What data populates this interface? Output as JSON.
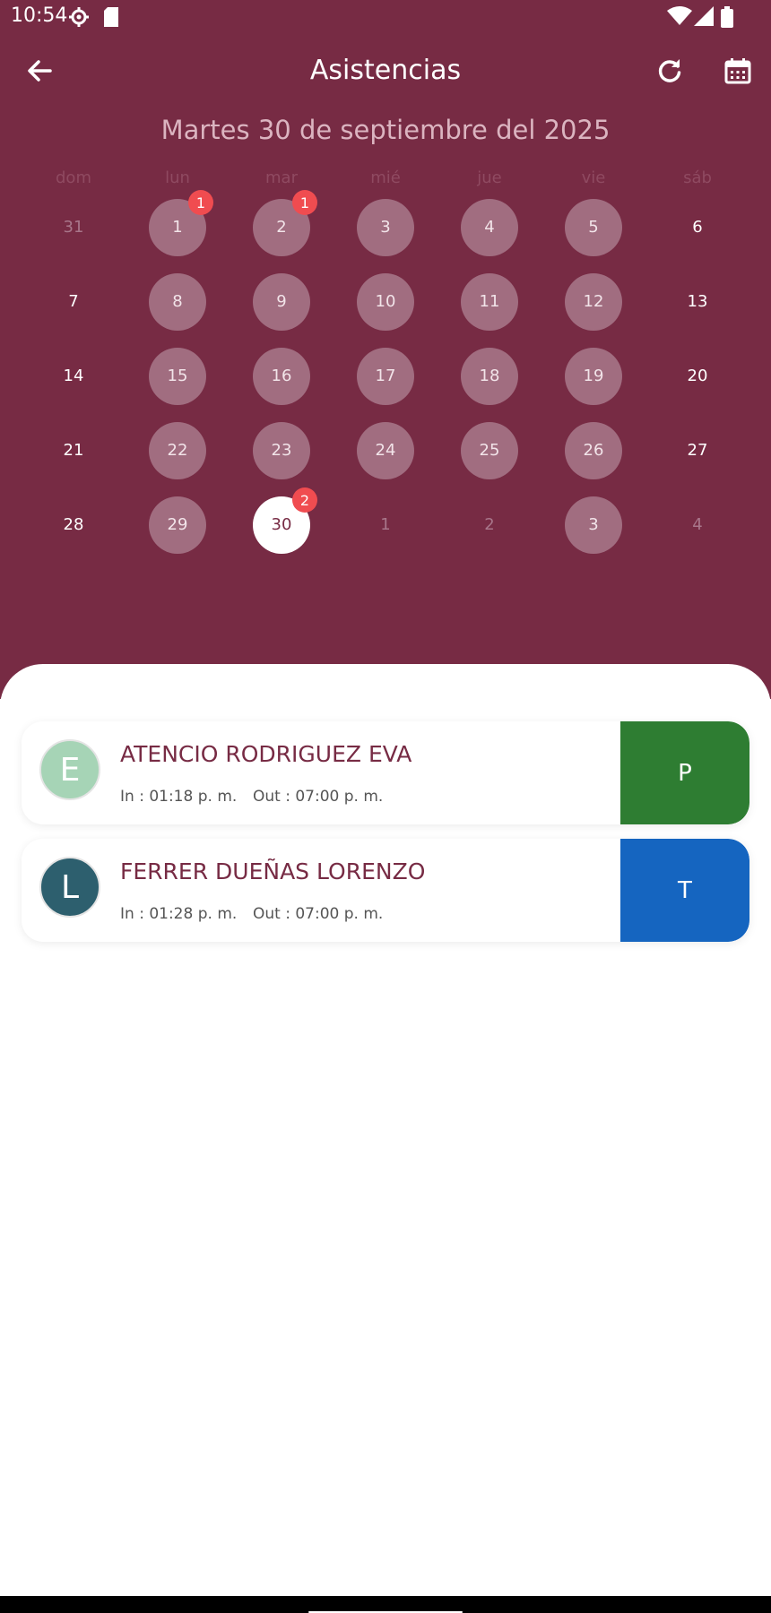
{
  "status_bar": {
    "time": "10:54"
  },
  "app_bar": {
    "title": "Asistencias"
  },
  "calendar": {
    "date_title": "Martes 30 de septiembre del 2025",
    "weekdays": [
      "dom",
      "lun",
      "mar",
      "mié",
      "jue",
      "vie",
      "sáb"
    ],
    "days": [
      {
        "label": "31",
        "kind": "outside"
      },
      {
        "label": "1",
        "kind": "work",
        "badge": "1"
      },
      {
        "label": "2",
        "kind": "work",
        "badge": "1"
      },
      {
        "label": "3",
        "kind": "work"
      },
      {
        "label": "4",
        "kind": "work"
      },
      {
        "label": "5",
        "kind": "work"
      },
      {
        "label": "6",
        "kind": "weekend"
      },
      {
        "label": "7",
        "kind": "weekend"
      },
      {
        "label": "8",
        "kind": "work"
      },
      {
        "label": "9",
        "kind": "work"
      },
      {
        "label": "10",
        "kind": "work"
      },
      {
        "label": "11",
        "kind": "work"
      },
      {
        "label": "12",
        "kind": "work"
      },
      {
        "label": "13",
        "kind": "weekend"
      },
      {
        "label": "14",
        "kind": "weekend"
      },
      {
        "label": "15",
        "kind": "work"
      },
      {
        "label": "16",
        "kind": "work"
      },
      {
        "label": "17",
        "kind": "work"
      },
      {
        "label": "18",
        "kind": "work"
      },
      {
        "label": "19",
        "kind": "work"
      },
      {
        "label": "20",
        "kind": "weekend"
      },
      {
        "label": "21",
        "kind": "weekend"
      },
      {
        "label": "22",
        "kind": "work"
      },
      {
        "label": "23",
        "kind": "work"
      },
      {
        "label": "24",
        "kind": "work"
      },
      {
        "label": "25",
        "kind": "work"
      },
      {
        "label": "26",
        "kind": "work"
      },
      {
        "label": "27",
        "kind": "weekend"
      },
      {
        "label": "28",
        "kind": "weekend"
      },
      {
        "label": "29",
        "kind": "work"
      },
      {
        "label": "30",
        "kind": "selected",
        "badge": "2"
      },
      {
        "label": "1",
        "kind": "outside"
      },
      {
        "label": "2",
        "kind": "outside"
      },
      {
        "label": "3",
        "kind": "work"
      },
      {
        "label": "4",
        "kind": "outside"
      }
    ]
  },
  "attendance": [
    {
      "initial": "E",
      "avatar_color": "#a6d4b6",
      "name": "ATENCIO RODRIGUEZ EVA",
      "in": "In : 01:18 p. m.",
      "out": "Out : 07:00 p. m.",
      "status": "P",
      "status_color": "#2e7d32"
    },
    {
      "initial": "L",
      "avatar_color": "#2d5f6e",
      "name": "FERRER DUEÑAS LORENZO",
      "in": "In : 01:28 p. m.",
      "out": "Out : 07:00 p. m.",
      "status": "T",
      "status_color": "#1565c0"
    }
  ],
  "icons": {
    "back": "arrow-left-icon",
    "refresh": "refresh-icon",
    "calendar": "calendar-icon"
  },
  "colors": {
    "header_bg": "#772b44",
    "badge": "#f04c50"
  }
}
